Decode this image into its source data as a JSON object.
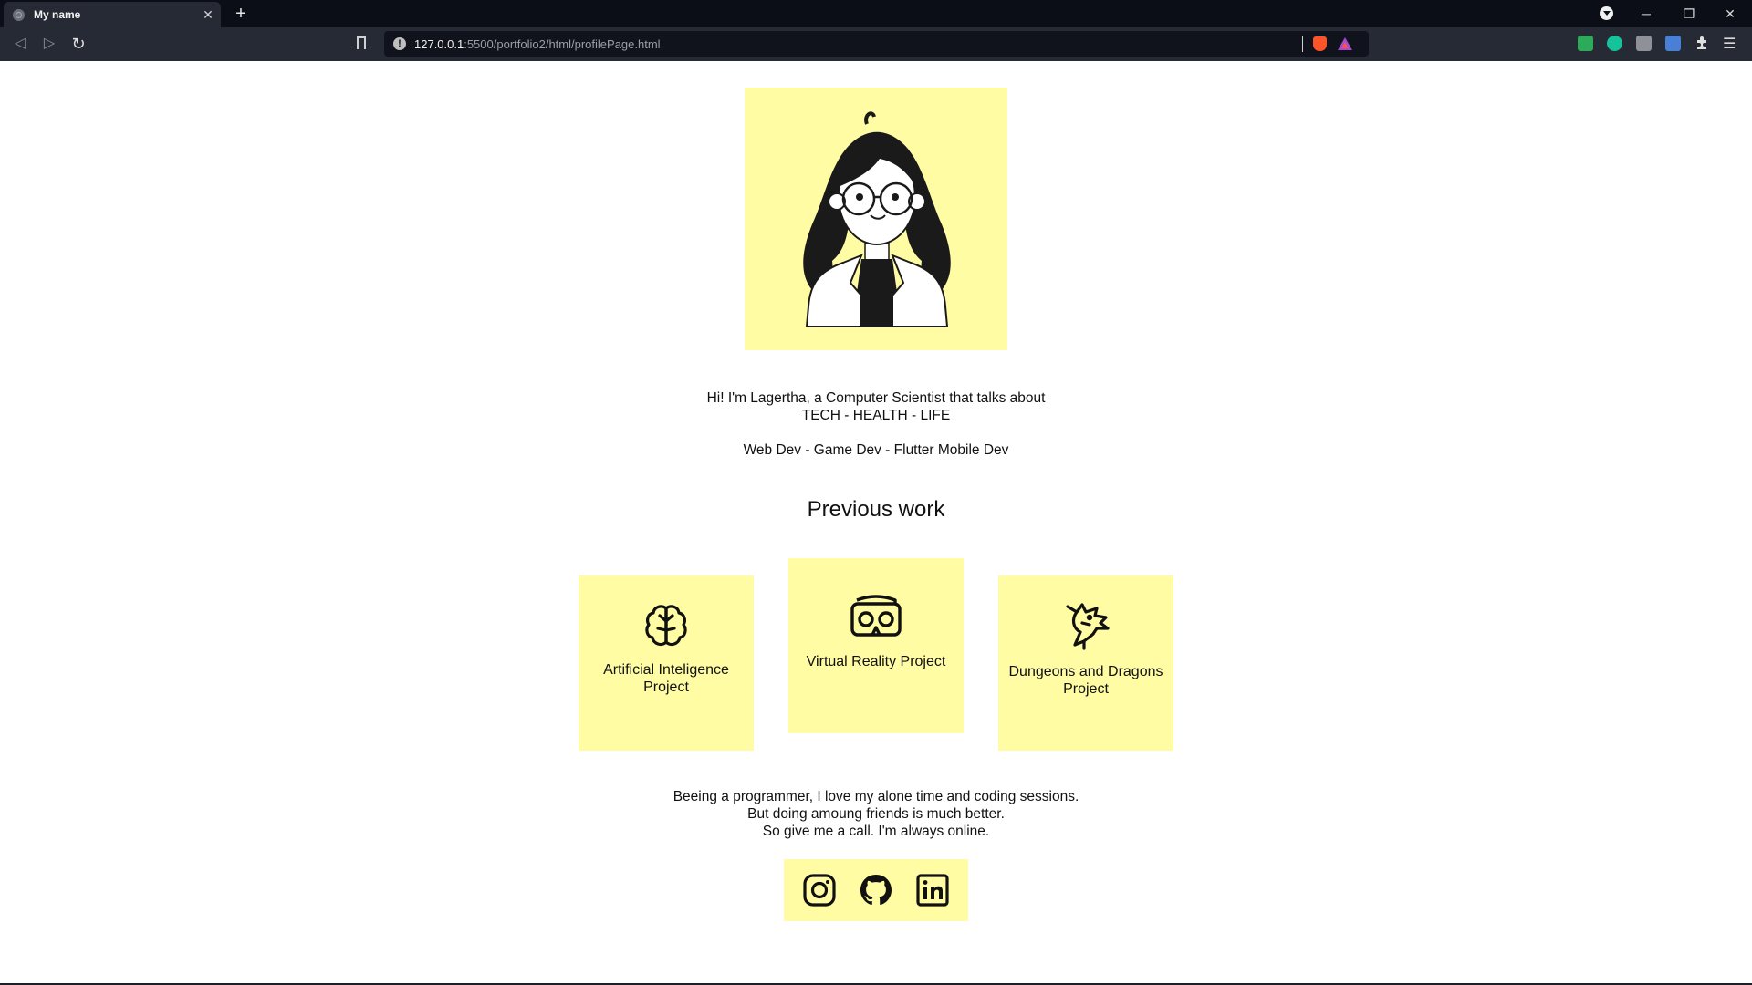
{
  "browser": {
    "tab_title": "My name",
    "tab_close": "✕",
    "new_tab": "+",
    "url_host": "127.0.0.1",
    "url_path": ":5500/portfolio2/html/profilePage.html",
    "window_controls": {
      "minimize": "─",
      "restore": "❐",
      "close": "✕"
    },
    "nav": {
      "back": "◁",
      "forward": "▷",
      "reload": "↻"
    },
    "menu_glyph": "☰"
  },
  "profile": {
    "avatar_icon": "girl-with-glasses-avatar",
    "intro_line1": "Hi! I'm Lagertha, a Computer Scientist that talks about",
    "intro_line2": "TECH - HEALTH - LIFE",
    "intro_line3": "Web Dev - Game Dev - Flutter Mobile Dev"
  },
  "previous_work": {
    "title": "Previous work",
    "projects": [
      {
        "label": "Artificial Inteligence Project",
        "icon": "brain-icon"
      },
      {
        "label": "Virtual Reality Project",
        "icon": "vr-headset-icon"
      },
      {
        "label": "Dungeons and Dragons Project",
        "icon": "dragon-icon"
      }
    ]
  },
  "contact": {
    "line1": "Beeing a programmer, I love my alone time and coding sessions.",
    "line2": "But doing amoung friends is much better.",
    "line3": "So give me a call. I'm always online.",
    "socials": [
      "instagram-icon",
      "github-icon",
      "linkedin-icon"
    ]
  },
  "colors": {
    "accent": "#fffca3",
    "chrome_dark": "#0b0e16",
    "chrome_toolbar": "#262a34",
    "text": "#111111"
  }
}
